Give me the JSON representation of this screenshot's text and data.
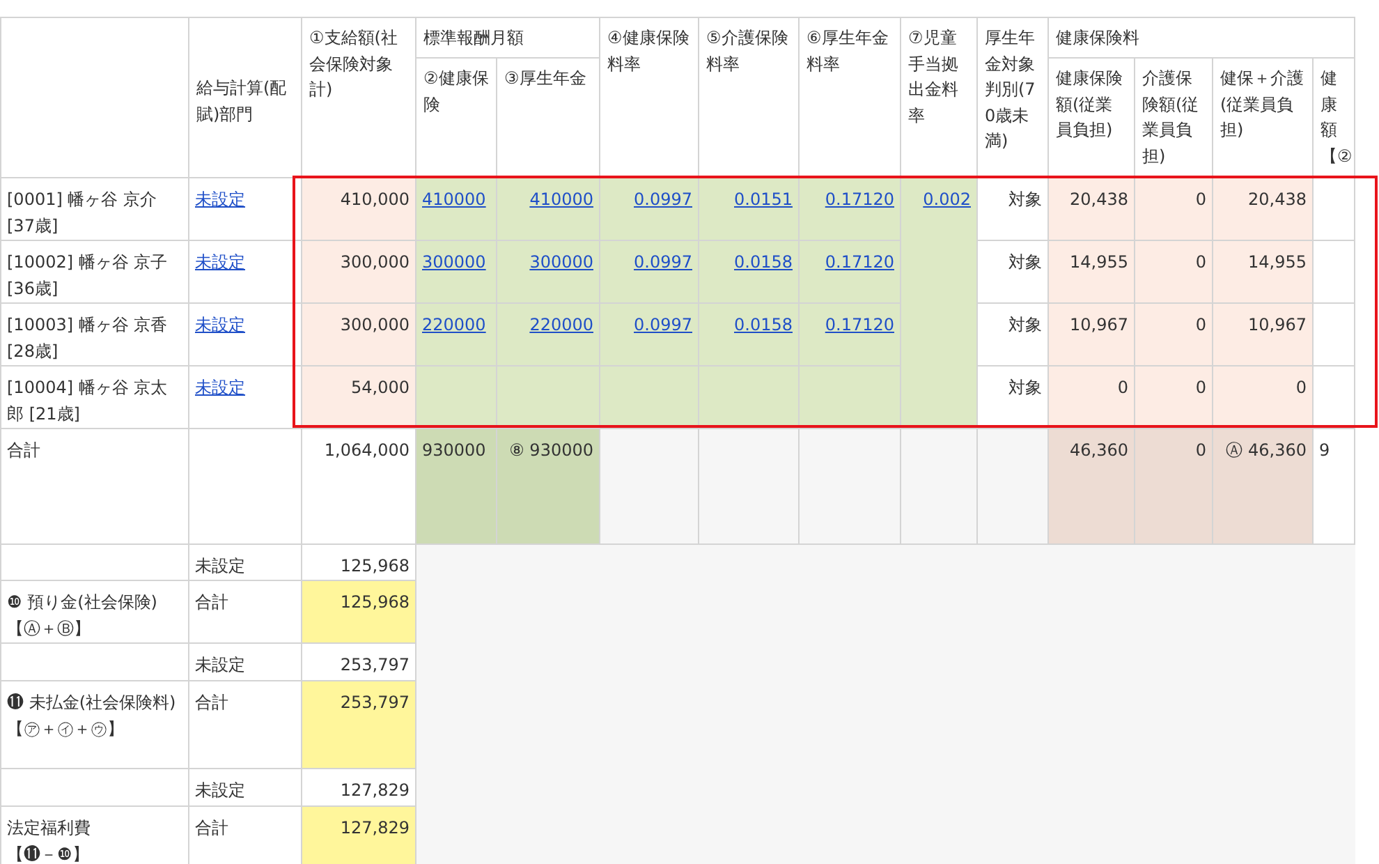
{
  "header": [
    {
      "kind": "blank"
    },
    {
      "kind": "centered",
      "label": "給与計算(配賦)部門"
    },
    {
      "kind": "single",
      "label": "①支給額(社会保険対象計)"
    },
    {
      "kind": "group",
      "label": "標準報酬月額",
      "children": [
        "②健康保険",
        "③厚生年金"
      ]
    },
    {
      "kind": "single",
      "label": "④健康保険料率"
    },
    {
      "kind": "single",
      "label": "⑤介護保険料率"
    },
    {
      "kind": "single",
      "label": "⑥厚生年金料率"
    },
    {
      "kind": "single",
      "label": "⑦児童手当拠出金料率"
    },
    {
      "kind": "single",
      "label": "厚生年金対象判別(70歳未満)"
    },
    {
      "kind": "group",
      "label": "健康保険料",
      "children": [
        "健康保険額(従業員負担)",
        "介護保険額(従業員負担)",
        "健保＋介護(従業員負担)",
        "健康額【②"
      ]
    }
  ],
  "child_rate": "0.002",
  "employees": [
    {
      "name": "[0001] 幡ヶ谷 京介 [37歳]",
      "dept": "未設定",
      "pay": "410,000",
      "health_std": "410000",
      "pension_std": "410000",
      "health_rate": "0.0997",
      "care_rate": "0.0151",
      "pension_rate": "0.17120",
      "target": "対象",
      "health_amt": "20,438",
      "care_amt": "0",
      "sum_amt": "20,438"
    },
    {
      "name": "[10002] 幡ヶ谷 京子 [36歳]",
      "dept": "未設定",
      "pay": "300,000",
      "health_std": "300000",
      "pension_std": "300000",
      "health_rate": "0.0997",
      "care_rate": "0.0158",
      "pension_rate": "0.17120",
      "target": "対象",
      "health_amt": "14,955",
      "care_amt": "0",
      "sum_amt": "14,955"
    },
    {
      "name": "[10003] 幡ヶ谷 京香 [28歳]",
      "dept": "未設定",
      "pay": "300,000",
      "health_std": "220000",
      "pension_std": "220000",
      "health_rate": "0.0997",
      "care_rate": "0.0158",
      "pension_rate": "0.17120",
      "target": "対象",
      "health_amt": "10,967",
      "care_amt": "0",
      "sum_amt": "10,967"
    },
    {
      "name": "[10004] 幡ヶ谷 京太郎 [21歳]",
      "dept": "未設定",
      "pay": "54,000",
      "target": "対象",
      "health_amt": "0",
      "care_amt": "0",
      "sum_amt": "0"
    }
  ],
  "total": {
    "label": "合計",
    "pay": "1,064,000",
    "health_std": "930000",
    "pension_std": "⑧ 930000",
    "health_amt": "46,360",
    "care_amt": "0",
    "sum_amt": "Ⓐ 46,360",
    "column_13": "9"
  },
  "summary": [
    {
      "kind": "dept",
      "dept": "未設定",
      "value": "125,968"
    },
    {
      "kind": "total",
      "label": "❿ 預り金(社会保険)",
      "formula": "【Ⓐ＋Ⓑ】",
      "dept": "合計",
      "value": "125,968"
    },
    {
      "kind": "dept",
      "dept": "未設定",
      "value": "253,797"
    },
    {
      "kind": "total",
      "label": "⓫ 未払金(社会保険料)",
      "formula": "【㋐＋㋑＋㋒】",
      "dept": "合計",
      "value": "253,797"
    },
    {
      "kind": "dept",
      "dept": "未設定",
      "value": "127,829"
    },
    {
      "kind": "total",
      "label": "法定福利費",
      "formula": "【⓫－❿】",
      "dept": "合計",
      "value": "127,829"
    }
  ]
}
